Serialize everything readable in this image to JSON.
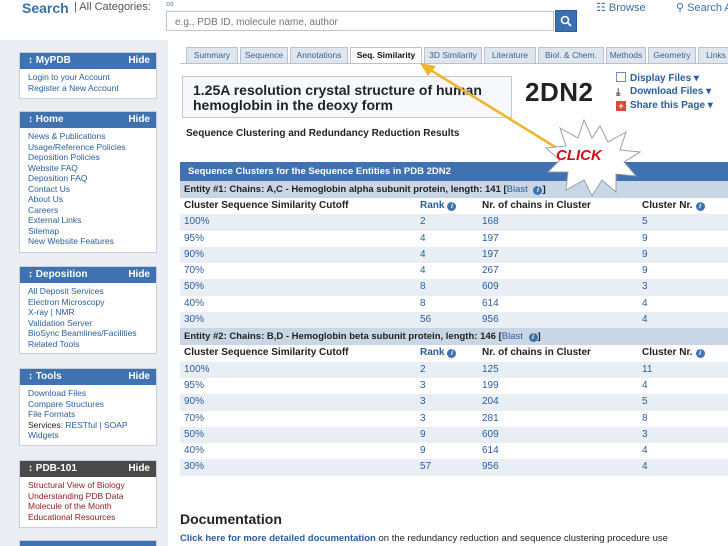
{
  "search": {
    "label": "Search",
    "categories": "| All Categories:",
    "placeholder": "e.g., PDB ID, molecule name, author",
    "browse": "Browse",
    "advanced": "Search Adva"
  },
  "sidebar": {
    "hide_label": "Hide",
    "mypdb": {
      "title": "MyPDB",
      "items": [
        "Login to your Account",
        "Register a New Account"
      ]
    },
    "home": {
      "title": "Home",
      "items": [
        "News & Publications",
        "Usage/Reference Policies",
        "Deposition Policies",
        "Website FAQ",
        "Deposition FAQ",
        "Contact Us",
        "About Us",
        "Careers",
        "External Links",
        "Sitemap",
        "New Website Features"
      ]
    },
    "deposition": {
      "title": "Deposition",
      "items": [
        "All Deposit Services",
        "Electron Microscopy",
        "X-ray | NMR",
        "Validation Server",
        "BioSync Beamlines/Facilities",
        "Related Tools"
      ]
    },
    "tools": {
      "title": "Tools",
      "items": [
        "Download Files",
        "Compare Structures",
        "File Formats"
      ],
      "services_prefix": "Services: ",
      "services_link": "RESTful | SOAP",
      "last": "Widgets"
    },
    "pdb101": {
      "title": "PDB-101",
      "items": [
        "Structural View of Biology",
        "Understanding PDB Data",
        "Molecule of the Month",
        "Educational Resources"
      ]
    }
  },
  "tabs": [
    "Summary",
    "Sequence",
    "Annotations",
    "Seq. Similarity",
    "3D Similarity",
    "Literature",
    "Biol. & Chem.",
    "Methods",
    "Geometry",
    "Links"
  ],
  "active_tab": "Seq. Similarity",
  "structure": {
    "title": "1.25A resolution crystal structure of human hemoglobin in the deoxy form",
    "id": "2DN2",
    "display_files": "Display Files ▾",
    "download_files": "Download Files ▾",
    "share": "Share this Page ▾"
  },
  "subheading": "Sequence Clustering and Redundancy Reduction Results",
  "table": {
    "header": "Sequence Clusters for the Sequence Entities in PDB 2DN2",
    "columns": [
      "Cluster Sequence Similarity Cutoff",
      "Rank",
      "Nr. of chains in Cluster",
      "Cluster Nr."
    ],
    "entities": [
      {
        "label": "Entity #1: Chains: A,C - Hemoglobin alpha subunit protein, length: 141 [",
        "blast": "Blast",
        "rows": [
          [
            "100%",
            "2",
            "168",
            "5"
          ],
          [
            "95%",
            "4",
            "197",
            "9"
          ],
          [
            "90%",
            "4",
            "197",
            "9"
          ],
          [
            "70%",
            "4",
            "267",
            "9"
          ],
          [
            "50%",
            "8",
            "609",
            "3"
          ],
          [
            "40%",
            "8",
            "614",
            "4"
          ],
          [
            "30%",
            "56",
            "956",
            "4"
          ]
        ]
      },
      {
        "label": "Entity #2: Chains: B,D - Hemoglobin beta subunit protein, length: 146 [",
        "blast": "Blast",
        "rows": [
          [
            "100%",
            "2",
            "125",
            "11"
          ],
          [
            "95%",
            "3",
            "199",
            "4"
          ],
          [
            "90%",
            "3",
            "204",
            "5"
          ],
          [
            "70%",
            "3",
            "281",
            "8"
          ],
          [
            "50%",
            "9",
            "609",
            "3"
          ],
          [
            "40%",
            "9",
            "614",
            "4"
          ],
          [
            "30%",
            "57",
            "956",
            "4"
          ]
        ]
      }
    ]
  },
  "documentation": {
    "heading": "Documentation",
    "link": "Click here for more detailed documentation",
    "rest": " on the redundancy reduction and sequence clustering procedure use"
  },
  "annotation": {
    "label": "CLICK",
    "color": "#d0101a"
  },
  "colors": {
    "accent": "#3f72b0",
    "link": "#2a5d9f",
    "row_alt": "#e9eef5",
    "entity_row": "#c9d6e6"
  }
}
